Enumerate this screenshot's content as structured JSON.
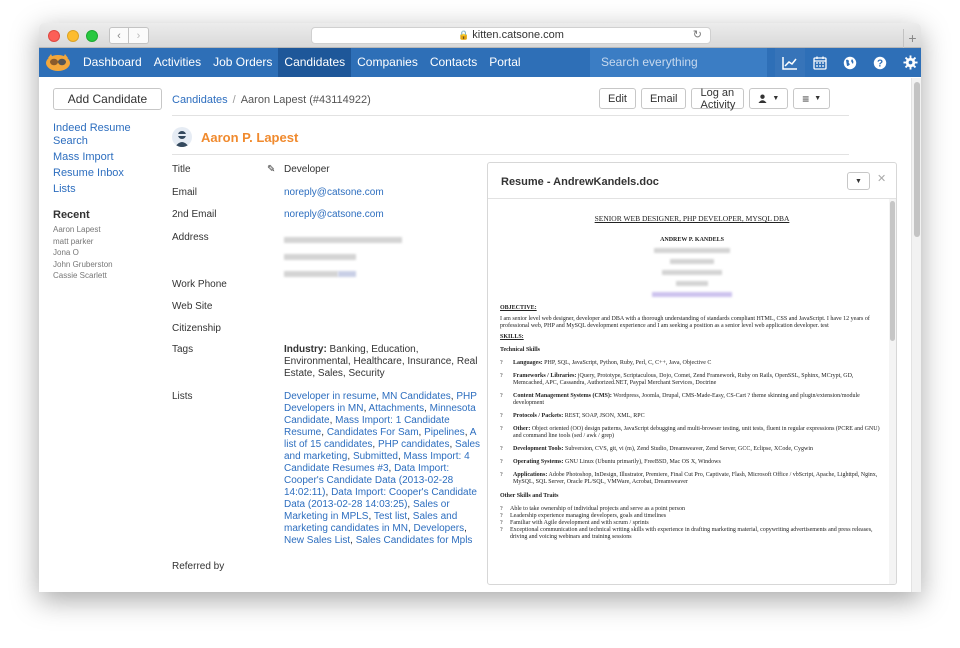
{
  "browser": {
    "url": "kitten.catsone.com"
  },
  "nav": {
    "items": [
      "Dashboard",
      "Activities",
      "Job Orders",
      "Candidates",
      "Companies",
      "Contacts",
      "Portal"
    ],
    "active": "Candidates",
    "search_placeholder": "Search everything",
    "icons": [
      "chart-icon",
      "calendar-icon",
      "globe-icon",
      "help-icon",
      "gear-icon"
    ]
  },
  "sidebar": {
    "add_label": "Add Candidate",
    "links": [
      "Indeed Resume Search",
      "Mass Import",
      "Resume Inbox",
      "Lists"
    ],
    "recent_title": "Recent",
    "recent": [
      "Aaron Lapest",
      "matt parker",
      "Jona O",
      "John Gruberston",
      "Cassie Scarlett"
    ]
  },
  "breadcrumb": {
    "root": "Candidates",
    "current": "Aaron Lapest (#43114922)"
  },
  "actions": {
    "edit": "Edit",
    "email": "Email",
    "log": "Log an Activity"
  },
  "candidate": {
    "name": "Aaron P. Lapest",
    "fields": [
      {
        "label": "Title",
        "value": "Developer"
      },
      {
        "label": "Email",
        "value": "noreply@catsone.com"
      },
      {
        "label": "2nd Email",
        "value": "noreply@catsone.com"
      },
      {
        "label": "Address",
        "value": ""
      },
      {
        "label": "Work Phone",
        "value": ""
      },
      {
        "label": "Web Site",
        "value": ""
      },
      {
        "label": "Citizenship",
        "value": ""
      },
      {
        "label": "Tags",
        "value": ""
      },
      {
        "label": "Lists",
        "value": ""
      },
      {
        "label": "Referred by",
        "value": ""
      }
    ],
    "tags_prefix": "Industry:",
    "tags_value": " Banking, Education, Environmental, Healthcare, Insurance, Real Estate, Sales, Security",
    "lists": [
      "Developer in resume",
      "MN Candidates",
      "PHP Developers in MN",
      "Attachments",
      "Minnesota Candidate",
      "Mass Import: 1 Candidate Resume",
      "Candidates For Sam",
      "Pipelines",
      "A list of 15 candidates",
      "PHP candidates",
      "Sales and marketing",
      "Submitted",
      "Mass Import: 4 Candidate Resumes #3",
      "Data Import: Cooper's Candidate Data (2013-02-28 14:02:11)",
      "Data Import: Cooper's Candidate Data (2013-02-28 14:03:25)",
      "Sales or Marketing in MPLS",
      "Test list",
      "Sales and marketing candidates in MN",
      "Developers",
      "New Sales List",
      "Sales Candidates for Mpls"
    ]
  },
  "resume": {
    "title": "Resume - AndrewKandels.doc",
    "heading": "SENIOR WEB DESIGNER, PHP DEVELOPER, MYSQL DBA",
    "author": "ANDREW P. KANDELS",
    "objective_title": "OBJECTIVE:",
    "objective": "I am senior level web designer, developer and DBA with a thorough understanding of standards compliant HTML, CSS and JavaScript. I have 12 years of professional web, PHP and MySQL development experience and I am seeking a position as a senior level web application developer. test",
    "skills_title": "SKILLS:",
    "tech_title": "Technical Skills",
    "bullet": "?",
    "skills": [
      {
        "k": "Languages:",
        "v": " PHP, SQL, JavaScript, Python, Ruby, Perl, C, C++, Java, Objective C"
      },
      {
        "k": "Frameworks / Libraries:",
        "v": " jQuery, Prototype, Scriptaculous, Dojo, Comet, Zend Framework, Ruby on Rails, OpenSSL, Sphinx, MCrypt, GD, Memcached, APC, Cassandra, Authorized.NET, Paypal Merchant Services, Doctrine"
      },
      {
        "k": "Content Management Systems (CMS):",
        "v": " Wordpress, Joomla, Drupal, CMS-Made-Easy, CS-Cart ? theme skinning and plugin/extension/module development"
      },
      {
        "k": "Protocols / Packets:",
        "v": " REST, SOAP, JSON, XML, RPC"
      },
      {
        "k": "Other:",
        "v": " Object oriented (OO) design patterns, JavaScript debugging and multi-browser testing, unit tests, fluent in regular expressions (PCRE and GNU) and command line tools (sed / awk / grep)"
      },
      {
        "k": "Development Tools:",
        "v": " Subversion, CVS, git, vi (m), Zend Studio, Dreamweaver, Zend Server, GCC, Eclipse, XCode, Cygwin"
      },
      {
        "k": "Operating Systems:",
        "v": " GNU Linux (Ubuntu primarily), FreeBSD, Mac OS X, Windows"
      },
      {
        "k": "Applications:",
        "v": " Adobe Photoshop, InDesign, Illustrator, Premiere, Final Cut Pro, Captivate, Flash, Microsoft Office / vbScript, Apache, Lighttpd, Nginx, MySQL, SQL Server, Oracle PL/SQL, VMWare, Acrobat, Dreamweaver"
      }
    ],
    "other_title": "Other Skills and Traits",
    "other": [
      "Able to take ownership of individual projects and serve as a point person",
      "Leadership experience managing developers, goals and timelines",
      "Familiar with Agile development and with scrum / sprints",
      "Exceptional communication and technical writing skills with experience in drafting marketing material, copywriting advertisements and press releases, driving and voicing webinars and training sessions"
    ]
  }
}
